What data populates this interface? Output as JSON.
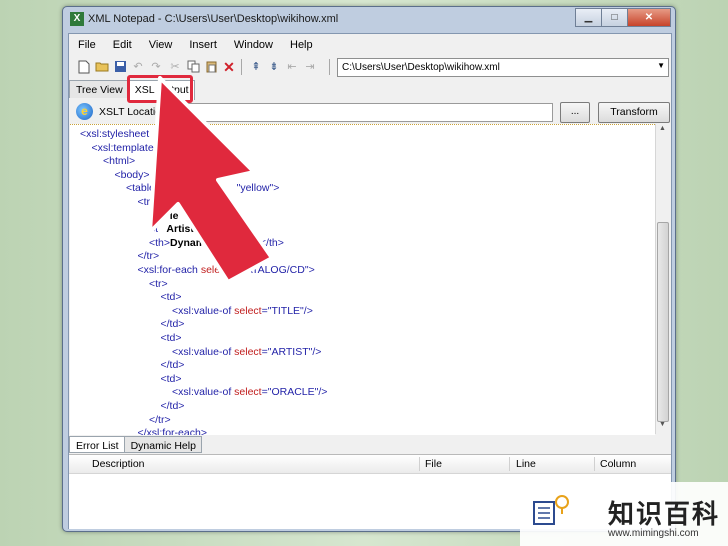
{
  "window": {
    "title": "XML Notepad - C:\\Users\\User\\Desktop\\wikihow.xml",
    "app_icon_glyph": "X",
    "controls": {
      "minimize": "▁",
      "maximize": "□",
      "close": "✕"
    }
  },
  "menu": [
    "File",
    "Edit",
    "View",
    "Insert",
    "Window",
    "Help"
  ],
  "toolbar": {
    "icons": [
      "new-file-icon",
      "open-folder-icon",
      "save-icon",
      "undo-icon",
      "redo-icon",
      "cut-icon",
      "copy-icon",
      "paste-icon",
      "delete-icon",
      "nudge-up-icon",
      "nudge-down-icon",
      "nudge-left-icon",
      "nudge-right-icon"
    ],
    "path_value": "C:\\Users\\User\\Desktop\\wikihow.xml"
  },
  "tabs": [
    {
      "label": "Tree View",
      "active": false
    },
    {
      "label": "XSL Output",
      "active": true
    }
  ],
  "xslt": {
    "label": "XSLT Location",
    "value": "",
    "browse_label": "...",
    "transform_label": "Transform"
  },
  "code_lines": [
    {
      "indent": 0,
      "parts": [
        [
          "tag",
          "<xsl:stylesheet"
        ],
        [
          "attr",
          "            "
        ],
        [
          "val",
          "\"1.0\">"
        ]
      ]
    },
    {
      "indent": 1,
      "parts": [
        [
          "tag",
          "<xsl:template"
        ]
      ]
    },
    {
      "indent": 2,
      "parts": [
        [
          "tag",
          "<html>"
        ]
      ]
    },
    {
      "indent": 3,
      "parts": [
        [
          "tag",
          "<body>"
        ]
      ]
    },
    {
      "indent": 4,
      "parts": [
        [
          "tag",
          "<table b"
        ],
        [
          "attr",
          "                         "
        ],
        [
          "val",
          "\"yellow\">"
        ]
      ]
    },
    {
      "indent": 5,
      "parts": [
        [
          "tag",
          "<tr>"
        ]
      ]
    },
    {
      "indent": 6,
      "parts": [
        [
          "tag",
          "<t"
        ],
        [
          "txt",
          "    le"
        ]
      ]
    },
    {
      "indent": 6,
      "parts": [
        [
          "tag",
          "<t"
        ],
        [
          "txt",
          "   Artist"
        ]
      ]
    },
    {
      "indent": 6,
      "parts": [
        [
          "tag",
          "<th>"
        ],
        [
          "txt",
          "Dynam          ntent"
        ],
        [
          "tag",
          "</th>"
        ]
      ]
    },
    {
      "indent": 5,
      "parts": [
        [
          "tag",
          "</tr>"
        ]
      ]
    },
    {
      "indent": 5,
      "parts": [
        [
          "tag",
          "<xsl:for-each "
        ],
        [
          "attr",
          "select"
        ],
        [
          "tag",
          "="
        ],
        [
          "val",
          "\"CATALOG/CD\">"
        ]
      ]
    },
    {
      "indent": 6,
      "parts": [
        [
          "tag",
          "<tr>"
        ]
      ]
    },
    {
      "indent": 7,
      "parts": [
        [
          "tag",
          "<td>"
        ]
      ]
    },
    {
      "indent": 8,
      "parts": [
        [
          "tag",
          "<xsl:value-of "
        ],
        [
          "attr",
          "select"
        ],
        [
          "tag",
          "="
        ],
        [
          "val",
          "\"TITLE\"/>"
        ]
      ]
    },
    {
      "indent": 7,
      "parts": [
        [
          "tag",
          "</td>"
        ]
      ]
    },
    {
      "indent": 7,
      "parts": [
        [
          "tag",
          "<td>"
        ]
      ]
    },
    {
      "indent": 8,
      "parts": [
        [
          "tag",
          "<xsl:value-of "
        ],
        [
          "attr",
          "select"
        ],
        [
          "tag",
          "="
        ],
        [
          "val",
          "\"ARTIST\"/>"
        ]
      ]
    },
    {
      "indent": 7,
      "parts": [
        [
          "tag",
          "</td>"
        ]
      ]
    },
    {
      "indent": 7,
      "parts": [
        [
          "tag",
          "<td>"
        ]
      ]
    },
    {
      "indent": 8,
      "parts": [
        [
          "tag",
          "<xsl:value-of "
        ],
        [
          "attr",
          "select"
        ],
        [
          "tag",
          "="
        ],
        [
          "val",
          "\"ORACLE\"/>"
        ]
      ]
    },
    {
      "indent": 7,
      "parts": [
        [
          "tag",
          "</td>"
        ]
      ]
    },
    {
      "indent": 6,
      "parts": [
        [
          "tag",
          "</tr>"
        ]
      ]
    },
    {
      "indent": 5,
      "parts": [
        [
          "tag",
          "</xsl:for-each>"
        ]
      ]
    }
  ],
  "bottom_tabs": [
    {
      "label": "Error List",
      "active": true
    },
    {
      "label": "Dynamic Help",
      "active": false
    }
  ],
  "error_list": {
    "columns": [
      "Description",
      "File",
      "Line",
      "Column"
    ]
  },
  "watermark": {
    "chinese": "知识百科",
    "url": "www.mimingshi.com"
  },
  "colors": {
    "highlight_red": "#e0293d",
    "tag_blue": "#2323a8",
    "attr_red": "#c01c1c"
  }
}
